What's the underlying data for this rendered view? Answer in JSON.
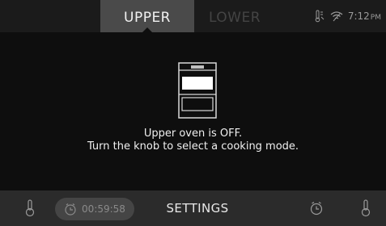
{
  "tabs": [
    {
      "label": "UPPER",
      "active": true
    },
    {
      "label": "LOWER",
      "active": false
    }
  ],
  "status": {
    "time": "7:12",
    "ampm": "PM",
    "icons": [
      "thermometer-probe-icon",
      "wifi-icon"
    ]
  },
  "message": {
    "line1": "Upper oven is OFF.",
    "line2": "Turn the knob to select a cooking mode."
  },
  "bottom_bar": {
    "timer_value": "00:59:58",
    "settings_label": "SETTINGS",
    "icons": [
      "probe-icon",
      "timer-icon",
      "alarm-clock-icon",
      "probe-icon"
    ]
  },
  "colors": {
    "background": "#0e0e0e",
    "active_tab": "#4a4a4a",
    "bottom_bar": "#2b2b2b"
  }
}
